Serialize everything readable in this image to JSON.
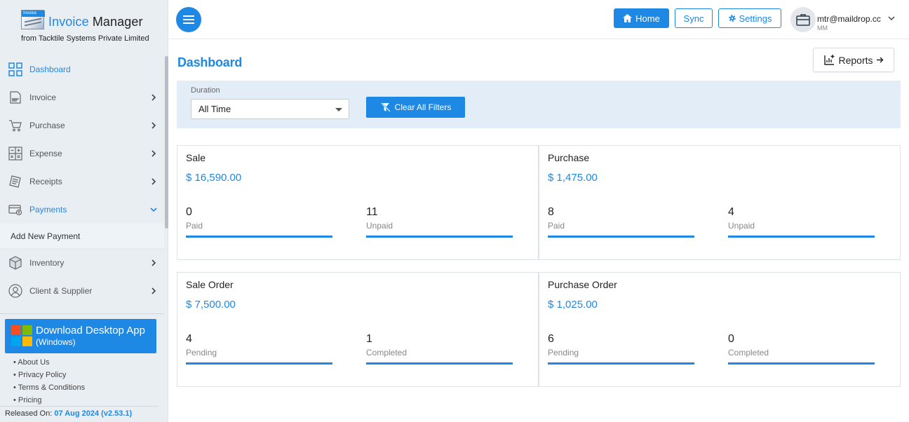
{
  "app": {
    "logo_tag": "Invoice",
    "name_part1": "Invoice",
    "name_part2": " Manager",
    "subtitle": "from Tacktile Systems Private Limited"
  },
  "sidebar": {
    "items": [
      {
        "label": "Dashboard",
        "icon": "dashboard-grid-icon",
        "active": true
      },
      {
        "label": "Invoice",
        "icon": "invoice-icon"
      },
      {
        "label": "Purchase",
        "icon": "cart-icon"
      },
      {
        "label": "Expense",
        "icon": "calculator-icon"
      },
      {
        "label": "Receipts",
        "icon": "receipt-icon"
      },
      {
        "label": "Payments",
        "icon": "payment-card-icon",
        "expanded": true
      },
      {
        "label": "Inventory",
        "icon": "box-icon"
      },
      {
        "label": "Client & Supplier",
        "icon": "user-icon"
      }
    ],
    "submenu": {
      "label": "Add New Payment"
    },
    "download": {
      "line1": "Download Desktop App",
      "line2": "(Windows)"
    },
    "links": [
      "• About Us",
      "• Privacy Policy",
      "• Terms & Conditions",
      "• Pricing"
    ],
    "release_label": "Released On:",
    "release_value": "07 Aug 2024 (v2.53.1)"
  },
  "topbar": {
    "home_label": "Home",
    "sync_label": "Sync",
    "settings_label": "Settings",
    "user_email": "mtr@maildrop.cc",
    "user_initials": "MM"
  },
  "main": {
    "title": "Dashboard",
    "reports_label": "Reports",
    "filter": {
      "duration_label": "Duration",
      "duration_value": "All Time",
      "clear_label": "Clear All Filters"
    },
    "cards": [
      {
        "title": "Sale",
        "amount": "$ 16,590.00",
        "stats": [
          {
            "value": "0",
            "label": "Paid"
          },
          {
            "value": "11",
            "label": "Unpaid"
          }
        ]
      },
      {
        "title": "Purchase",
        "amount": "$ 1,475.00",
        "stats": [
          {
            "value": "8",
            "label": "Paid"
          },
          {
            "value": "4",
            "label": "Unpaid"
          }
        ]
      },
      {
        "title": "Sale Order",
        "amount": "$ 7,500.00",
        "stats": [
          {
            "value": "4",
            "label": "Pending"
          },
          {
            "value": "1",
            "label": "Completed"
          }
        ]
      },
      {
        "title": "Purchase Order",
        "amount": "$ 1,025.00",
        "stats": [
          {
            "value": "6",
            "label": "Pending"
          },
          {
            "value": "0",
            "label": "Completed"
          }
        ]
      }
    ]
  },
  "colors": {
    "accent": "#1e88e5",
    "sidebar_bg": "#e9eef3",
    "filter_bg": "#e3edf7"
  }
}
